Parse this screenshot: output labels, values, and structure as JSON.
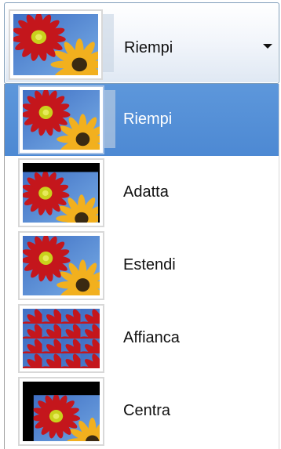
{
  "combo": {
    "selected_label": "Riempi",
    "arrow_icon": "chevron-down-icon"
  },
  "options": [
    {
      "label": "Riempi",
      "mode": "fill",
      "selected": true
    },
    {
      "label": "Adatta",
      "mode": "fit",
      "selected": false
    },
    {
      "label": "Estendi",
      "mode": "stretch",
      "selected": false
    },
    {
      "label": "Affianca",
      "mode": "tile",
      "selected": false
    },
    {
      "label": "Centra",
      "mode": "center",
      "selected": false
    }
  ],
  "colors": {
    "selection": "#5d97db",
    "sky": "#5b8fd6",
    "petal_red": "#c4161c",
    "petal_yellow": "#f2b01e",
    "flower_center": "#c9d21c"
  }
}
